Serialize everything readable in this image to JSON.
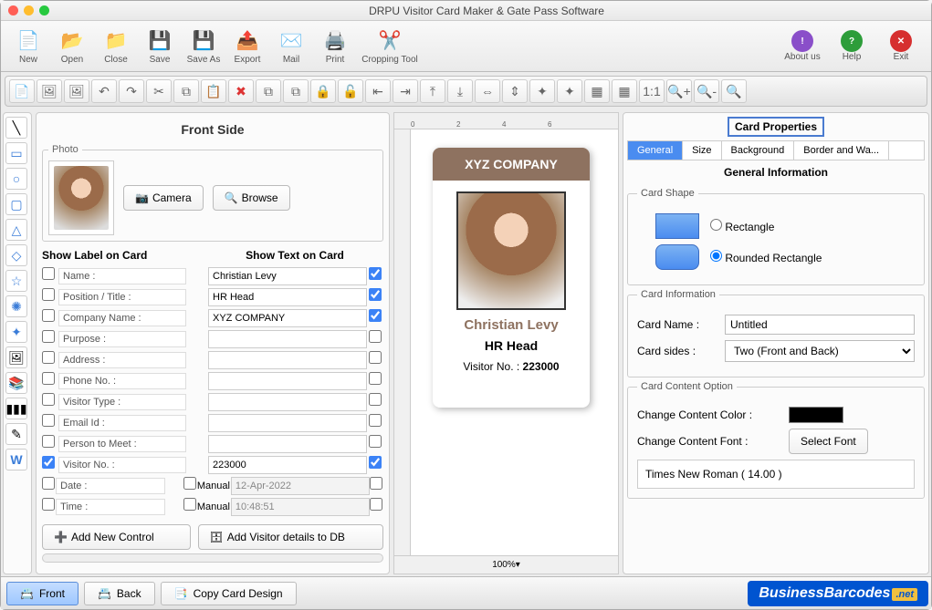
{
  "window": {
    "title": "DRPU Visitor Card Maker & Gate Pass Software"
  },
  "toolbar": {
    "new": "New",
    "open": "Open",
    "close": "Close",
    "save": "Save",
    "saveas": "Save As",
    "export": "Export",
    "mail": "Mail",
    "print": "Print",
    "crop": "Cropping Tool",
    "about": "About us",
    "help": "Help",
    "exit": "Exit"
  },
  "frontside": {
    "title": "Front Side",
    "photo_legend": "Photo",
    "camera": "Camera",
    "browse": "Browse",
    "show_label": "Show Label on Card",
    "show_text": "Show Text on Card",
    "rows": [
      {
        "label": "Name :",
        "value": "Christian Levy",
        "cb1": false,
        "cb3": true
      },
      {
        "label": "Position / Title :",
        "value": "HR Head",
        "cb1": false,
        "cb3": true
      },
      {
        "label": "Company Name :",
        "value": "XYZ COMPANY",
        "cb1": false,
        "cb3": true
      },
      {
        "label": "Purpose :",
        "value": "",
        "cb1": false,
        "cb3": false
      },
      {
        "label": "Address :",
        "value": "",
        "cb1": false,
        "cb3": false
      },
      {
        "label": "Phone No. :",
        "value": "",
        "cb1": false,
        "cb3": false
      },
      {
        "label": "Visitor Type :",
        "value": "",
        "cb1": false,
        "cb3": false
      },
      {
        "label": "Email Id :",
        "value": "",
        "cb1": false,
        "cb3": false
      },
      {
        "label": "Person to Meet :",
        "value": "",
        "cb1": false,
        "cb3": false
      },
      {
        "label": "Visitor No. :",
        "value": "223000",
        "cb1": true,
        "cb3": true
      },
      {
        "label": "Date :",
        "value": "12-Apr-2022",
        "manual": "Manual",
        "cb1": false,
        "cb3": false,
        "dis": true
      },
      {
        "label": "Time :",
        "value": "10:48:51",
        "manual": "Manual",
        "cb1": false,
        "cb3": false,
        "dis": true
      }
    ],
    "add_control": "Add New Control",
    "add_db": "Add Visitor details to DB"
  },
  "canvas": {
    "zoom": "100%",
    "ruler": [
      "0",
      "2",
      "4",
      "6"
    ]
  },
  "card": {
    "company": "XYZ COMPANY",
    "name": "Christian Levy",
    "role": "HR Head",
    "visitor_label": "Visitor No. :",
    "visitor_no": "223000"
  },
  "props": {
    "title": "Card Properties",
    "tabs": [
      "General",
      "Size",
      "Background",
      "Border and Wa..."
    ],
    "section": "General Information",
    "shape_legend": "Card Shape",
    "shape_rect": "Rectangle",
    "shape_rrect": "Rounded Rectangle",
    "info_legend": "Card Information",
    "card_name_lbl": "Card Name :",
    "card_name": "Untitled",
    "sides_lbl": "Card sides :",
    "sides": "Two (Front and Back)",
    "content_legend": "Card Content Option",
    "color_lbl": "Change Content Color :",
    "font_lbl": "Change Content Font :",
    "select_font": "Select Font",
    "font_display": "Times New Roman ( 14.00 )"
  },
  "bottom": {
    "front": "Front",
    "back": "Back",
    "copy": "Copy Card Design"
  },
  "logo": {
    "text": "BusinessBarcodes",
    "ext": ".net"
  }
}
